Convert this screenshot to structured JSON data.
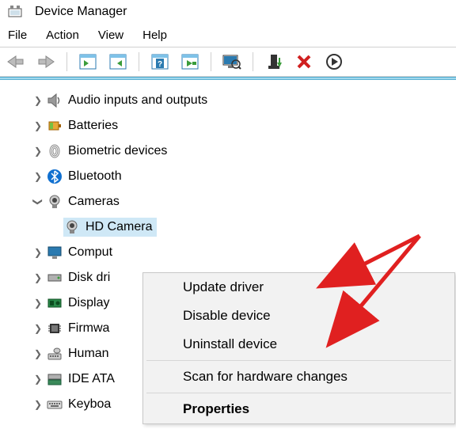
{
  "window": {
    "title": "Device Manager"
  },
  "menu": {
    "file": "File",
    "action": "Action",
    "view": "View",
    "help": "Help"
  },
  "tree": {
    "audio": {
      "label": "Audio inputs and outputs"
    },
    "batt": {
      "label": "Batteries"
    },
    "biom": {
      "label": "Biometric devices"
    },
    "bt": {
      "label": "Bluetooth"
    },
    "cam": {
      "label": "Cameras"
    },
    "hdcam": {
      "label": "HD Camera"
    },
    "comp": {
      "label": "Comput"
    },
    "disk": {
      "label": "Disk dri"
    },
    "disp": {
      "label": "Display"
    },
    "firm": {
      "label": "Firmwa"
    },
    "human": {
      "label": "Human"
    },
    "ide": {
      "label": "IDE ATA"
    },
    "kbd": {
      "label": "Keyboa"
    }
  },
  "context_menu": {
    "update": "Update driver",
    "disable": "Disable device",
    "uninstall": "Uninstall device",
    "scan": "Scan for hardware changes",
    "props": "Properties"
  }
}
